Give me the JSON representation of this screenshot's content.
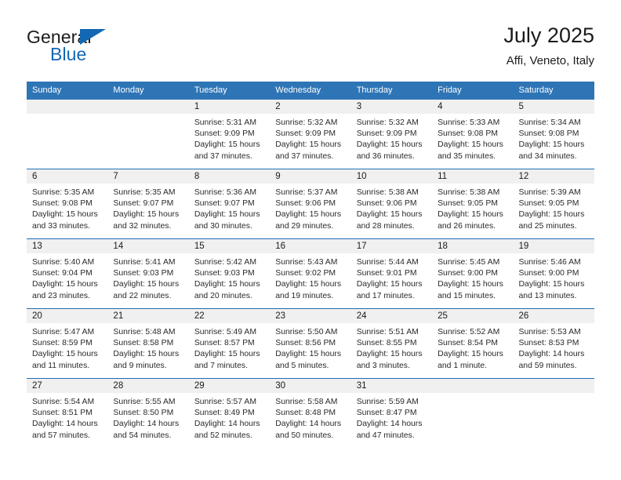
{
  "brand": {
    "name_part1": "General",
    "name_part2": "Blue",
    "accent_color": "#1268b3"
  },
  "header": {
    "title": "July 2025",
    "subtitle": "Affi, Veneto, Italy"
  },
  "theme": {
    "header_blue": "#2e75b6",
    "row_divider_blue": "#1f6eb5",
    "daynum_band_gray": "#f0f0f0"
  },
  "calendar": {
    "weekday_headers": [
      "Sunday",
      "Monday",
      "Tuesday",
      "Wednesday",
      "Thursday",
      "Friday",
      "Saturday"
    ],
    "weeks": [
      [
        {
          "day": "",
          "lines": []
        },
        {
          "day": "",
          "lines": []
        },
        {
          "day": "1",
          "lines": [
            "Sunrise: 5:31 AM",
            "Sunset: 9:09 PM",
            "Daylight: 15 hours",
            "and 37 minutes."
          ]
        },
        {
          "day": "2",
          "lines": [
            "Sunrise: 5:32 AM",
            "Sunset: 9:09 PM",
            "Daylight: 15 hours",
            "and 37 minutes."
          ]
        },
        {
          "day": "3",
          "lines": [
            "Sunrise: 5:32 AM",
            "Sunset: 9:09 PM",
            "Daylight: 15 hours",
            "and 36 minutes."
          ]
        },
        {
          "day": "4",
          "lines": [
            "Sunrise: 5:33 AM",
            "Sunset: 9:08 PM",
            "Daylight: 15 hours",
            "and 35 minutes."
          ]
        },
        {
          "day": "5",
          "lines": [
            "Sunrise: 5:34 AM",
            "Sunset: 9:08 PM",
            "Daylight: 15 hours",
            "and 34 minutes."
          ]
        }
      ],
      [
        {
          "day": "6",
          "lines": [
            "Sunrise: 5:35 AM",
            "Sunset: 9:08 PM",
            "Daylight: 15 hours",
            "and 33 minutes."
          ]
        },
        {
          "day": "7",
          "lines": [
            "Sunrise: 5:35 AM",
            "Sunset: 9:07 PM",
            "Daylight: 15 hours",
            "and 32 minutes."
          ]
        },
        {
          "day": "8",
          "lines": [
            "Sunrise: 5:36 AM",
            "Sunset: 9:07 PM",
            "Daylight: 15 hours",
            "and 30 minutes."
          ]
        },
        {
          "day": "9",
          "lines": [
            "Sunrise: 5:37 AM",
            "Sunset: 9:06 PM",
            "Daylight: 15 hours",
            "and 29 minutes."
          ]
        },
        {
          "day": "10",
          "lines": [
            "Sunrise: 5:38 AM",
            "Sunset: 9:06 PM",
            "Daylight: 15 hours",
            "and 28 minutes."
          ]
        },
        {
          "day": "11",
          "lines": [
            "Sunrise: 5:38 AM",
            "Sunset: 9:05 PM",
            "Daylight: 15 hours",
            "and 26 minutes."
          ]
        },
        {
          "day": "12",
          "lines": [
            "Sunrise: 5:39 AM",
            "Sunset: 9:05 PM",
            "Daylight: 15 hours",
            "and 25 minutes."
          ]
        }
      ],
      [
        {
          "day": "13",
          "lines": [
            "Sunrise: 5:40 AM",
            "Sunset: 9:04 PM",
            "Daylight: 15 hours",
            "and 23 minutes."
          ]
        },
        {
          "day": "14",
          "lines": [
            "Sunrise: 5:41 AM",
            "Sunset: 9:03 PM",
            "Daylight: 15 hours",
            "and 22 minutes."
          ]
        },
        {
          "day": "15",
          "lines": [
            "Sunrise: 5:42 AM",
            "Sunset: 9:03 PM",
            "Daylight: 15 hours",
            "and 20 minutes."
          ]
        },
        {
          "day": "16",
          "lines": [
            "Sunrise: 5:43 AM",
            "Sunset: 9:02 PM",
            "Daylight: 15 hours",
            "and 19 minutes."
          ]
        },
        {
          "day": "17",
          "lines": [
            "Sunrise: 5:44 AM",
            "Sunset: 9:01 PM",
            "Daylight: 15 hours",
            "and 17 minutes."
          ]
        },
        {
          "day": "18",
          "lines": [
            "Sunrise: 5:45 AM",
            "Sunset: 9:00 PM",
            "Daylight: 15 hours",
            "and 15 minutes."
          ]
        },
        {
          "day": "19",
          "lines": [
            "Sunrise: 5:46 AM",
            "Sunset: 9:00 PM",
            "Daylight: 15 hours",
            "and 13 minutes."
          ]
        }
      ],
      [
        {
          "day": "20",
          "lines": [
            "Sunrise: 5:47 AM",
            "Sunset: 8:59 PM",
            "Daylight: 15 hours",
            "and 11 minutes."
          ]
        },
        {
          "day": "21",
          "lines": [
            "Sunrise: 5:48 AM",
            "Sunset: 8:58 PM",
            "Daylight: 15 hours",
            "and 9 minutes."
          ]
        },
        {
          "day": "22",
          "lines": [
            "Sunrise: 5:49 AM",
            "Sunset: 8:57 PM",
            "Daylight: 15 hours",
            "and 7 minutes."
          ]
        },
        {
          "day": "23",
          "lines": [
            "Sunrise: 5:50 AM",
            "Sunset: 8:56 PM",
            "Daylight: 15 hours",
            "and 5 minutes."
          ]
        },
        {
          "day": "24",
          "lines": [
            "Sunrise: 5:51 AM",
            "Sunset: 8:55 PM",
            "Daylight: 15 hours",
            "and 3 minutes."
          ]
        },
        {
          "day": "25",
          "lines": [
            "Sunrise: 5:52 AM",
            "Sunset: 8:54 PM",
            "Daylight: 15 hours",
            "and 1 minute."
          ]
        },
        {
          "day": "26",
          "lines": [
            "Sunrise: 5:53 AM",
            "Sunset: 8:53 PM",
            "Daylight: 14 hours",
            "and 59 minutes."
          ]
        }
      ],
      [
        {
          "day": "27",
          "lines": [
            "Sunrise: 5:54 AM",
            "Sunset: 8:51 PM",
            "Daylight: 14 hours",
            "and 57 minutes."
          ]
        },
        {
          "day": "28",
          "lines": [
            "Sunrise: 5:55 AM",
            "Sunset: 8:50 PM",
            "Daylight: 14 hours",
            "and 54 minutes."
          ]
        },
        {
          "day": "29",
          "lines": [
            "Sunrise: 5:57 AM",
            "Sunset: 8:49 PM",
            "Daylight: 14 hours",
            "and 52 minutes."
          ]
        },
        {
          "day": "30",
          "lines": [
            "Sunrise: 5:58 AM",
            "Sunset: 8:48 PM",
            "Daylight: 14 hours",
            "and 50 minutes."
          ]
        },
        {
          "day": "31",
          "lines": [
            "Sunrise: 5:59 AM",
            "Sunset: 8:47 PM",
            "Daylight: 14 hours",
            "and 47 minutes."
          ]
        },
        {
          "day": "",
          "lines": []
        },
        {
          "day": "",
          "lines": []
        }
      ]
    ]
  }
}
